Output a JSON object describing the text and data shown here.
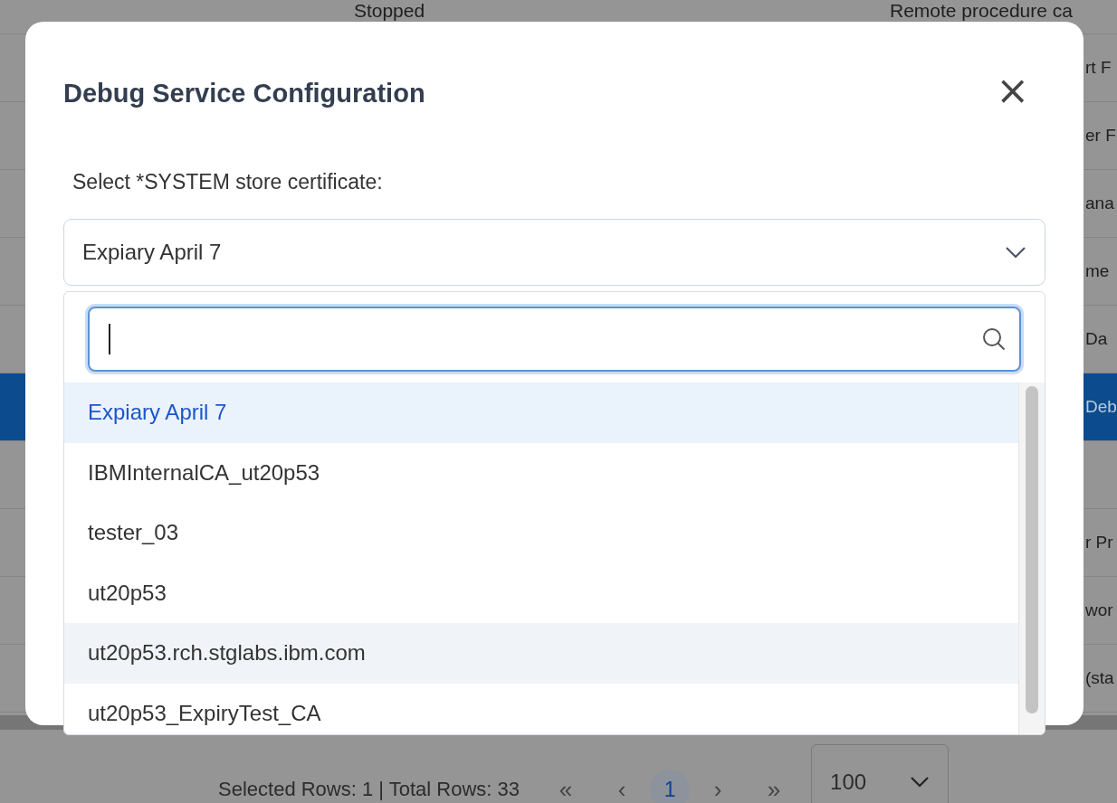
{
  "table": {
    "rows": [
      {
        "status": "Stopped",
        "description": "Remote procedure ca",
        "selected": false
      },
      {
        "description": "rt F",
        "selected": false
      },
      {
        "description": "er F",
        "selected": false
      },
      {
        "description": "ana",
        "selected": false
      },
      {
        "description": "me",
        "selected": false
      },
      {
        "description": "Da",
        "selected": false
      },
      {
        "description": "Deb",
        "selected": true
      },
      {
        "selected": false
      },
      {
        "description": "r Pr",
        "selected": false
      },
      {
        "description": "wor",
        "selected": false
      },
      {
        "description": "(sta",
        "selected": false
      }
    ]
  },
  "footer": {
    "summary": "Selected Rows: 1 | Total Rows: 33",
    "first": "«",
    "prev": "‹",
    "pages": [
      {
        "label": "1",
        "selected": true
      }
    ],
    "next": "›",
    "last": "»",
    "page_size": "100"
  },
  "dialog": {
    "title": "Debug Service Configuration",
    "close": "×",
    "label": "Select *SYSTEM store certificate:",
    "select": {
      "value": "Expiary April 7",
      "options": [
        {
          "label": "Expiary April 7",
          "selected": true,
          "hovered": false
        },
        {
          "label": "IBMInternalCA_ut20p53",
          "selected": false,
          "hovered": false
        },
        {
          "label": "tester_03",
          "selected": false,
          "hovered": false
        },
        {
          "label": "ut20p53",
          "selected": false,
          "hovered": false
        },
        {
          "label": "ut20p53.rch.stglabs.ibm.com",
          "selected": false,
          "hovered": true
        },
        {
          "label": "ut20p53_ExpiryTest_CA",
          "selected": false,
          "hovered": false
        }
      ]
    }
  }
}
